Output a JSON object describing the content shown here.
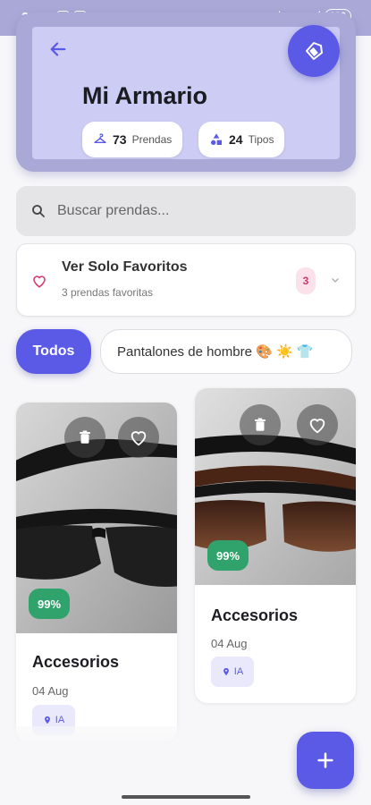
{
  "status_bar": {
    "time": "3:24",
    "network": "5G",
    "battery": "100"
  },
  "header": {
    "title": "Mi Armario",
    "stats": [
      {
        "count": "73",
        "label": "Prendas"
      },
      {
        "count": "24",
        "label": "Tipos"
      }
    ]
  },
  "search": {
    "placeholder": "Buscar prendas..."
  },
  "favorites": {
    "title": "Ver Solo Favoritos",
    "subtitle": "3 prendas favoritas",
    "count": "3"
  },
  "filters": [
    {
      "label": "Todos",
      "active": true
    },
    {
      "label": "Pantalones de hombre 🎨 ☀️ 👕",
      "active": false
    }
  ],
  "items": [
    {
      "category": "Accesorios",
      "date": "04 Aug",
      "confidence": "99%",
      "source": "IA"
    },
    {
      "category": "Accesorios",
      "date": "04 Aug",
      "confidence": "99%",
      "source": "IA"
    }
  ],
  "colors": {
    "accent": "#5b5ae6",
    "header_bg": "#ccccf4",
    "success": "#2fa36b",
    "favorite": "#d2336b"
  }
}
